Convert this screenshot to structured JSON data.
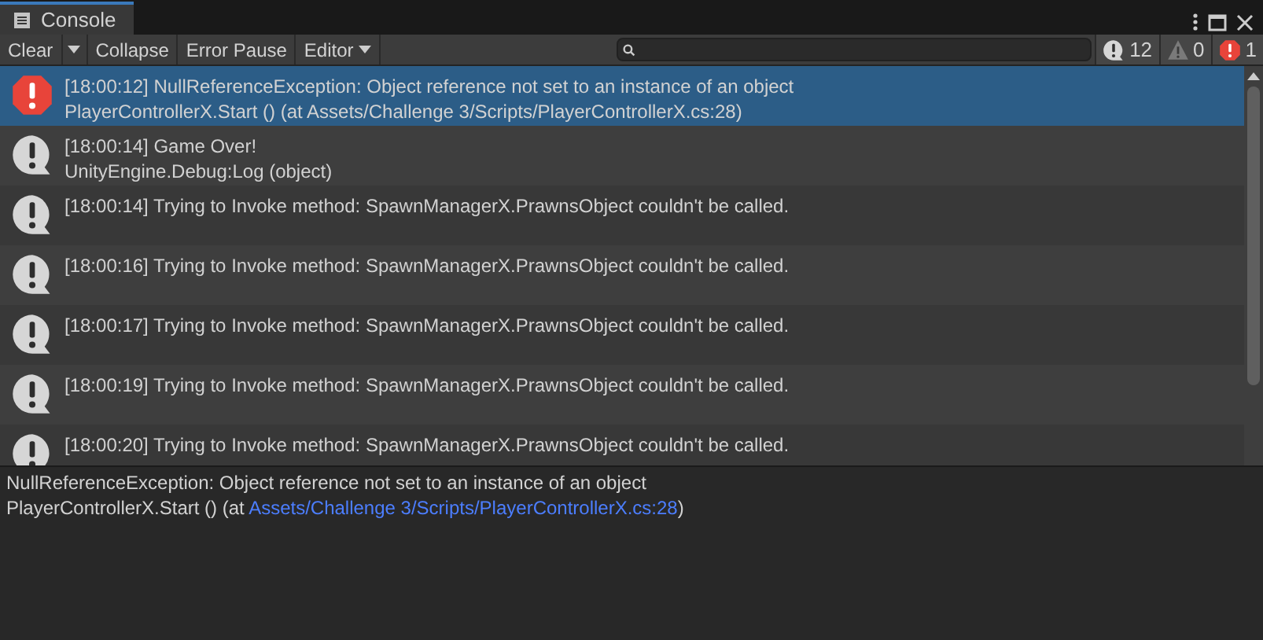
{
  "window": {
    "title": "Console"
  },
  "toolbar": {
    "buttons": [
      {
        "label": "Clear"
      },
      {
        "label": "Collapse"
      },
      {
        "label": "Error Pause"
      },
      {
        "label": "Editor"
      }
    ]
  },
  "counters": [
    {
      "kind": "log",
      "count": "12"
    },
    {
      "kind": "warning",
      "count": "0"
    },
    {
      "kind": "error",
      "count": "1"
    }
  ],
  "entries": [
    {
      "kind": "error",
      "selected": true,
      "lines": [
        "[18:00:12] NullReferenceException: Object reference not set to an instance of an object",
        "PlayerControllerX.Start () (at Assets/Challenge 3/Scripts/PlayerControllerX.cs:28)"
      ]
    },
    {
      "kind": "log",
      "selected": false,
      "lines": [
        "[18:00:14] Game Over!",
        "UnityEngine.Debug:Log (object)"
      ]
    },
    {
      "kind": "log",
      "selected": false,
      "lines": [
        "[18:00:14] Trying to Invoke method: SpawnManagerX.PrawnsObject couldn't be called."
      ]
    },
    {
      "kind": "log",
      "selected": false,
      "lines": [
        "[18:00:16] Trying to Invoke method: SpawnManagerX.PrawnsObject couldn't be called."
      ]
    },
    {
      "kind": "log",
      "selected": false,
      "lines": [
        "[18:00:17] Trying to Invoke method: SpawnManagerX.PrawnsObject couldn't be called."
      ]
    },
    {
      "kind": "log",
      "selected": false,
      "lines": [
        "[18:00:19] Trying to Invoke method: SpawnManagerX.PrawnsObject couldn't be called."
      ]
    },
    {
      "kind": "log",
      "selected": false,
      "lines": [
        "[18:00:20] Trying to Invoke method: SpawnManagerX.PrawnsObject couldn't be called."
      ]
    }
  ],
  "details": {
    "message": "NullReferenceException: Object reference not set to an instance of an object",
    "trace_prefix": "PlayerControllerX.Start () (at ",
    "trace_link": "Assets/Challenge 3/Scripts/PlayerControllerX.cs:28",
    "trace_suffix": ")"
  }
}
